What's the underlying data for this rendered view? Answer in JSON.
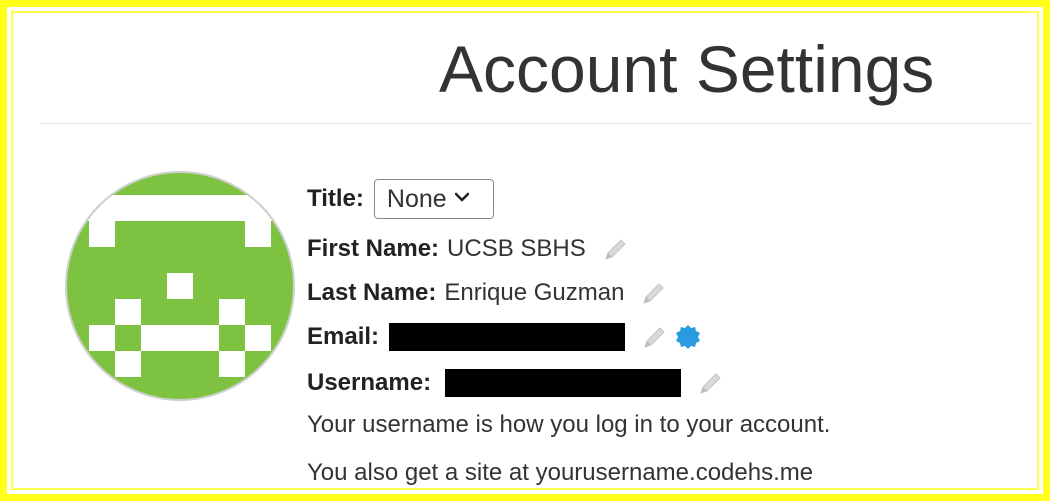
{
  "header": {
    "title": "Account Settings"
  },
  "profile": {
    "title_label": "Title:",
    "title_selected": "None",
    "first_name_label": "First Name:",
    "first_name_value": "UCSB SBHS",
    "last_name_label": "Last Name:",
    "last_name_value": "Enrique Guzman",
    "email_label": "Email:",
    "username_label": "Username:",
    "help_line_1": "Your username is how you log in to your account.",
    "help_line_2": "You also get a site at yourusername.codehs.me"
  },
  "icons": {
    "edit": "pencil-icon",
    "verified": "verified-badge-icon",
    "dropdown": "chevron-down-icon"
  },
  "colors": {
    "frame": "#ffff1a",
    "avatar_green": "#7dc241",
    "verified_blue": "#2b9be0",
    "redaction": "#000000"
  }
}
